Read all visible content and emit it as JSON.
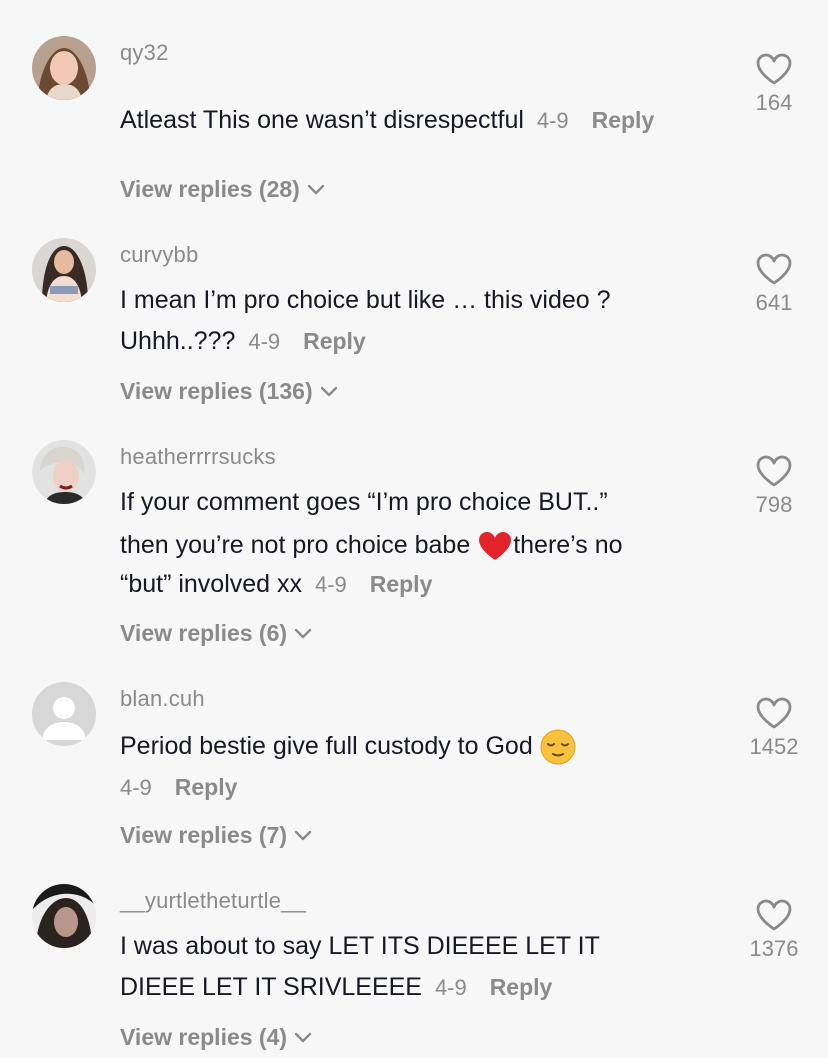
{
  "comments": [
    {
      "username": "qy32",
      "text": "Atleast This one wasn’t disrespectful",
      "date": "4-9",
      "reply_label": "Reply",
      "view_replies": "View replies (28)",
      "likes": "164"
    },
    {
      "username": "curvybb",
      "text_line1": "I mean I’m pro choice but like … this video ?",
      "text_line2": "Uhhh..???",
      "date": "4-9",
      "reply_label": "Reply",
      "view_replies": "View replies (136)",
      "likes": "641"
    },
    {
      "username": "heatherrrrsucks",
      "text_line1": "If your comment goes “I’m pro choice BUT..”",
      "text_line2a": "then you’re not pro choice babe ",
      "text_line2b": "there’s no",
      "text_line3": "“but” involved xx",
      "date": "4-9",
      "reply_label": "Reply",
      "view_replies": "View replies (6)",
      "likes": "798"
    },
    {
      "username": "blan.cuh",
      "text": "Period bestie give full custody to God ",
      "date": "4-9",
      "reply_label": "Reply",
      "view_replies": "View replies (7)",
      "likes": "1452"
    },
    {
      "username": "__yurtletheturtle__",
      "text_line1": "I was about to say LET ITS DIEEEE LET IT",
      "text_line2": "DIEEE LET IT SRIVLEEEE",
      "date": "4-9",
      "reply_label": "Reply",
      "view_replies": "View replies (4)",
      "likes": "1376"
    }
  ],
  "icons": {
    "like": "heart-outline-icon",
    "expand": "chevron-down-icon"
  },
  "colors": {
    "background": "#f7f7f7",
    "primary_text": "#161823",
    "secondary_text": "#8a8a8a"
  }
}
